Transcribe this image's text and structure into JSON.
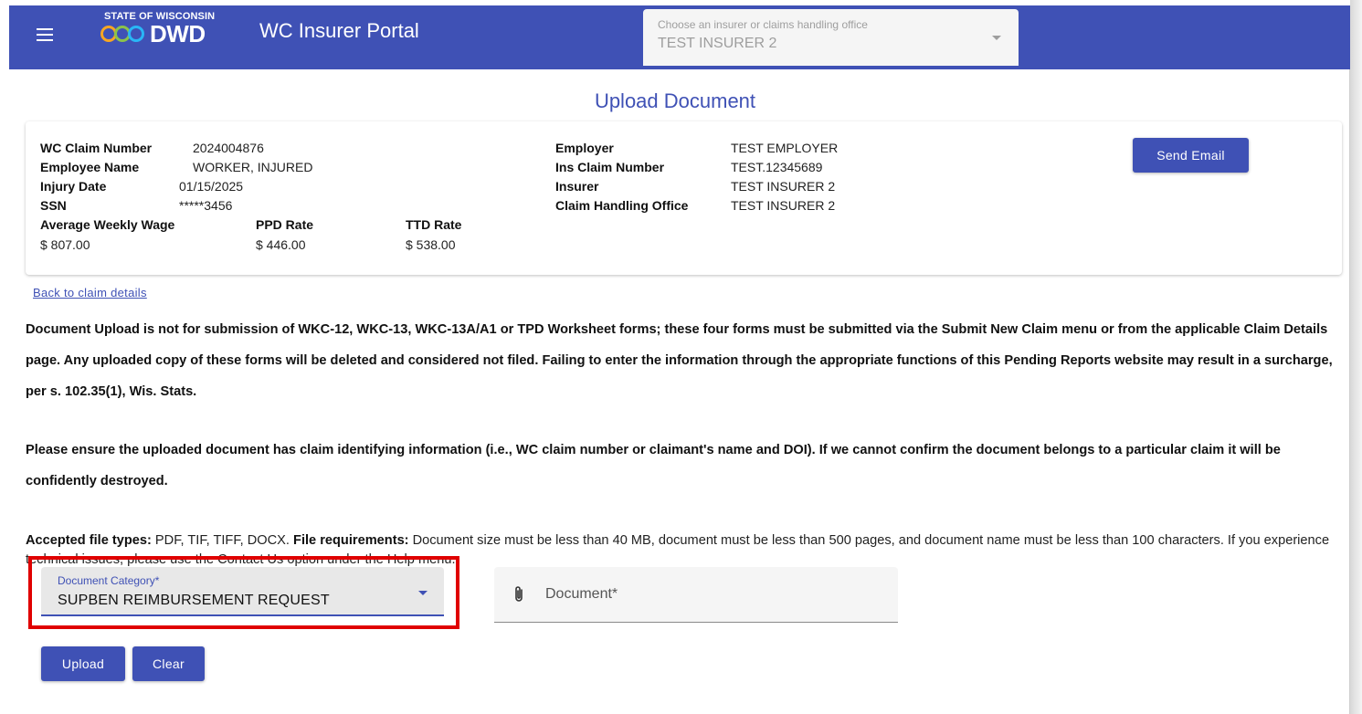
{
  "header": {
    "logo_top": "STATE OF WISCONSIN",
    "logo_text": "DWD",
    "app_title": "WC Insurer Portal",
    "insurer_select": {
      "placeholder": "Choose an insurer or claims handling office",
      "value": "TEST INSURER 2"
    },
    "colors": {
      "primary": "#3f51b5"
    }
  },
  "page_title": "Upload Document",
  "claim": {
    "left": [
      {
        "label": "WC Claim Number",
        "value": "2024004876"
      },
      {
        "label": "Employee Name",
        "value": "WORKER, INJURED"
      },
      {
        "label": "Injury Date",
        "value": "01/15/2025"
      },
      {
        "label": "SSN",
        "value": "*****3456"
      }
    ],
    "rates": [
      {
        "label": "Average Weekly Wage",
        "value": "$ 807.00"
      },
      {
        "label": "PPD Rate",
        "value": "$ 446.00"
      },
      {
        "label": "TTD Rate",
        "value": "$ 538.00"
      }
    ],
    "right": [
      {
        "label": "Employer",
        "value": "TEST EMPLOYER"
      },
      {
        "label": "Ins Claim Number",
        "value": "TEST.12345689"
      },
      {
        "label": "Insurer",
        "value": "TEST INSURER 2"
      },
      {
        "label": "Claim Handling Office",
        "value": "TEST INSURER 2"
      }
    ],
    "send_email_label": "Send Email"
  },
  "back_link": "Back to claim details",
  "notice1": "Document Upload is not for submission of WKC-12, WKC-13, WKC-13A/A1 or TPD Worksheet forms; these four forms must be submitted via the Submit New Claim menu or from the applicable Claim Details page. Any uploaded copy of these forms will be deleted and considered not filed. Failing to enter the information through the appropriate functions of this Pending Reports website may result in a surcharge, per s. 102.35(1), Wis. Stats.",
  "notice2": "Please ensure the uploaded document has claim identifying information (i.e., WC claim number or claimant's name and DOI). If we cannot confirm the document belongs to a particular claim it will be confidently destroyed.",
  "file_info": {
    "types_label": "Accepted file types:",
    "types_value": " PDF, TIF, TIFF, DOCX. ",
    "req_label": "File requirements:",
    "req_value": " Document size must be less than 40 MB, document must be less than 500 pages, and document name must be less than 100 characters. If you experience technical issues, please use the Contact Us option under the Help menu."
  },
  "form": {
    "category": {
      "placeholder": "Document Category*",
      "value": "SUPBEN REIMBURSEMENT REQUEST"
    },
    "document": {
      "label": "Document*"
    },
    "highlight_color": "#e00000",
    "upload_label": "Upload",
    "clear_label": "Clear"
  }
}
